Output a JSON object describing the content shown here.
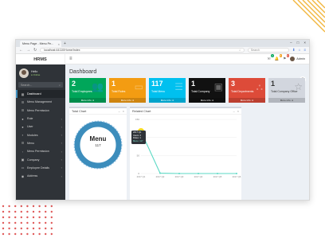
{
  "browser": {
    "tab_title": "Menu Page - Menu Pe...",
    "url": "localhost:44110/Home/Index",
    "search_placeholder": "Search"
  },
  "sidebar": {
    "brand": "HRMS",
    "user_name": "Hello",
    "user_status": "● Online",
    "search_placeholder": "Search...",
    "items": [
      {
        "label": "Dashboard",
        "icon": "dashboard-icon"
      },
      {
        "label": "Menu Management",
        "icon": "list-icon"
      },
      {
        "label": "Menu Permission",
        "icon": "list-icon"
      },
      {
        "label": "Role",
        "icon": "users-icon"
      },
      {
        "label": "User",
        "icon": "user-icon"
      },
      {
        "label": "Modules",
        "icon": "grid-icon"
      },
      {
        "label": "Menu",
        "icon": "list-icon"
      },
      {
        "label": "Menu Permission",
        "icon": "lock-icon"
      },
      {
        "label": "Company",
        "icon": "building-icon"
      },
      {
        "label": "Employee Details",
        "icon": "id-card-icon"
      },
      {
        "label": "Address",
        "icon": "map-pin-icon"
      }
    ]
  },
  "topbar": {
    "badges": [
      "4",
      "5",
      "9"
    ],
    "admin_label": "Admin"
  },
  "main": {
    "title": "Dashboard",
    "cards": [
      {
        "value": "2",
        "label": "Total Employees",
        "more": "More info",
        "color": "#00a65a",
        "icon": "users-icon"
      },
      {
        "value": "1",
        "label": "Total Roles",
        "more": "More info",
        "color": "#f39c12",
        "icon": "id-card-icon"
      },
      {
        "value": "117",
        "label": "Total Menu",
        "more": "More info",
        "color": "#00c0ef",
        "icon": "list-icon"
      },
      {
        "value": "1",
        "label": "Total Company",
        "more": "More info",
        "color": "#111111",
        "icon": "building-icon"
      },
      {
        "value": "3",
        "label": "Total Departments",
        "more": "More info",
        "color": "#dd4b39",
        "icon": "sitemap-icon"
      },
      {
        "value": "1",
        "label": "Total Company Office",
        "more": "More info",
        "color": "#d2d6de",
        "icon": "star-icon"
      }
    ]
  },
  "panels": {
    "total_chart_title": "Total Chart",
    "related_chart_title": "Related Chart"
  },
  "donut": {
    "label": "Menu",
    "value": "117",
    "color": "#3c8dbc"
  },
  "chart_data": {
    "type": "line",
    "title": "Related Chart",
    "categories": [
      "2017 Q1",
      "2017 Q2",
      "2017 Q3",
      "2017 Q4",
      "2017 Q5",
      "2017 Q6"
    ],
    "series": [
      {
        "name": "Total",
        "values": [
          117,
          1,
          0,
          0,
          0,
          0
        ],
        "color": "#5bd9c4"
      }
    ],
    "yticks": [
      0,
      50,
      100,
      150
    ],
    "ylim": [
      0,
      150
    ],
    "tooltip": {
      "title": "2017 Q1",
      "lines": [
        "Users: 2",
        "Roles: 1",
        "Menu: 117"
      ]
    }
  }
}
